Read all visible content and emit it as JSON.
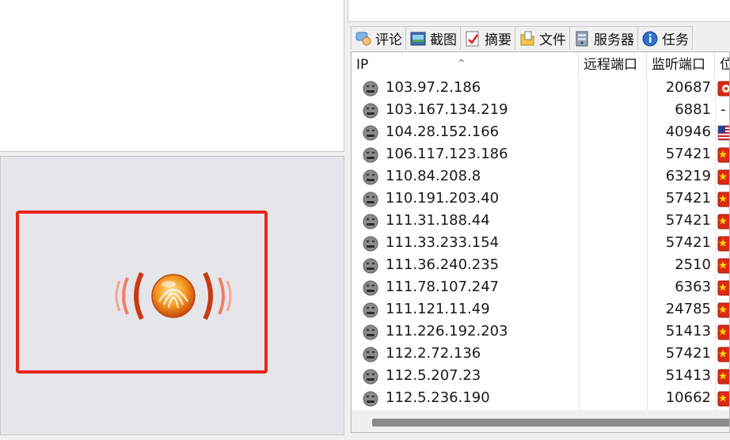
{
  "tabs": [
    {
      "label": "评论",
      "icon": "comment-icon"
    },
    {
      "label": "截图",
      "icon": "screenshot-icon"
    },
    {
      "label": "摘要",
      "icon": "summary-icon"
    },
    {
      "label": "文件",
      "icon": "files-icon"
    },
    {
      "label": "服务器",
      "icon": "server-icon"
    },
    {
      "label": "任务",
      "icon": "info-icon"
    }
  ],
  "table": {
    "columns": [
      "IP",
      "远程端口",
      "监听端口",
      "位"
    ],
    "sort_indicator": "^",
    "rows": [
      {
        "ip": "103.97.2.186",
        "port": "20687",
        "flag": "hk"
      },
      {
        "ip": "103.167.134.219",
        "port": "6881",
        "flag": "none"
      },
      {
        "ip": "104.28.152.166",
        "port": "40946",
        "flag": "us"
      },
      {
        "ip": "106.117.123.186",
        "port": "57421",
        "flag": "cn"
      },
      {
        "ip": "110.84.208.8",
        "port": "63219",
        "flag": "cn"
      },
      {
        "ip": "110.191.203.40",
        "port": "57421",
        "flag": "cn"
      },
      {
        "ip": "111.31.188.44",
        "port": "57421",
        "flag": "cn"
      },
      {
        "ip": "111.33.233.154",
        "port": "57421",
        "flag": "cn"
      },
      {
        "ip": "111.36.240.235",
        "port": "2510",
        "flag": "cn"
      },
      {
        "ip": "111.78.107.247",
        "port": "6363",
        "flag": "cn"
      },
      {
        "ip": "111.121.11.49",
        "port": "24785",
        "flag": "cn"
      },
      {
        "ip": "111.226.192.203",
        "port": "51413",
        "flag": "cn"
      },
      {
        "ip": "112.2.72.136",
        "port": "57421",
        "flag": "cn"
      },
      {
        "ip": "112.5.207.23",
        "port": "51413",
        "flag": "cn"
      },
      {
        "ip": "112.5.236.190",
        "port": "10662",
        "flag": "cn"
      }
    ],
    "no_flag_text": "-"
  },
  "colors": {
    "frame_red": "#e8261c",
    "flag_red": "#de2910",
    "flag_star": "#ffde00",
    "status_gray": "#8c8c8c"
  }
}
